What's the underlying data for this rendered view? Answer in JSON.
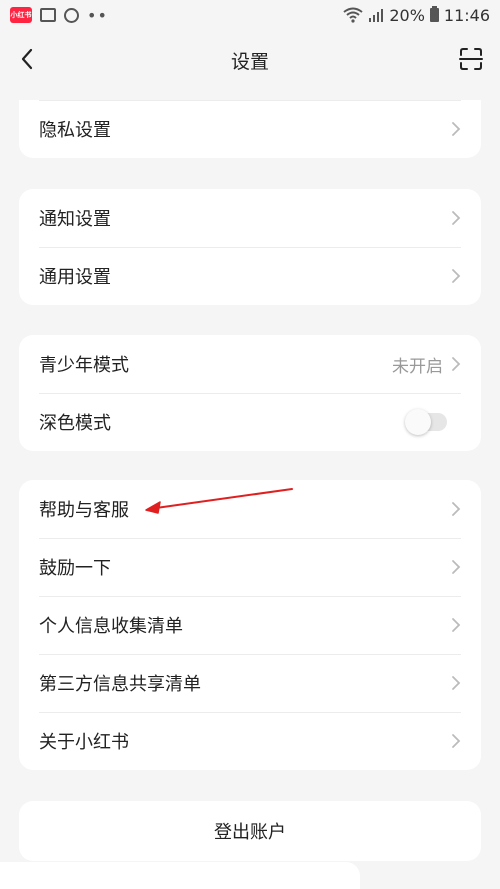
{
  "status_bar": {
    "app_badge": "小红书",
    "battery_percent": "20%",
    "time": "11:46"
  },
  "nav": {
    "title": "设置"
  },
  "settings": {
    "group1": [
      {
        "label": "隐私设置"
      }
    ],
    "group2": [
      {
        "label": "通知设置"
      },
      {
        "label": "通用设置"
      }
    ],
    "group3": [
      {
        "label": "青少年模式",
        "value": "未开启"
      },
      {
        "label": "深色模式",
        "toggle": false
      }
    ],
    "group4": [
      {
        "label": "帮助与客服"
      },
      {
        "label": "鼓励一下"
      },
      {
        "label": "个人信息收集清单"
      },
      {
        "label": "第三方信息共享清单"
      },
      {
        "label": "关于小红书"
      }
    ]
  },
  "logout": {
    "label": "登出账户"
  },
  "colors": {
    "background": "#f5f5f5",
    "card": "#ffffff",
    "annotation_arrow": "#e02020",
    "secondary_text": "#999999"
  }
}
